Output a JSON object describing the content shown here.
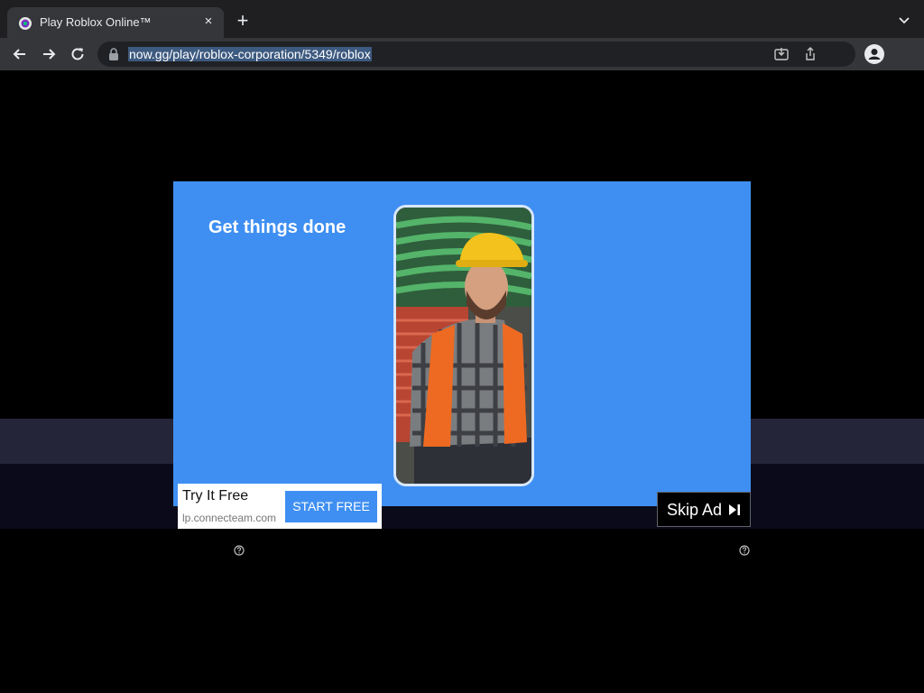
{
  "browser": {
    "tab_title": "Play Roblox Online™",
    "tab_close_glyph": "×",
    "new_tab_glyph": "+",
    "url": "now.gg/play/roblox-corporation/5349/roblox"
  },
  "ad": {
    "headline": "Get things done",
    "cta_title": "Try It Free",
    "cta_domain": "lp.connecteam.com",
    "cta_button": "START FREE",
    "skip_label": "Skip Ad"
  },
  "colors": {
    "ad_background": "#3f8ff2",
    "chrome_dark": "#1f1f22",
    "toolbar": "#35363a"
  },
  "icons": [
    "tab-favicon-icon",
    "close-icon",
    "plus-icon",
    "chevron-down-icon",
    "back-arrow-icon",
    "forward-arrow-icon",
    "reload-icon",
    "lock-icon",
    "install-icon",
    "share-icon",
    "profile-icon",
    "skip-next-icon",
    "help-icon"
  ]
}
